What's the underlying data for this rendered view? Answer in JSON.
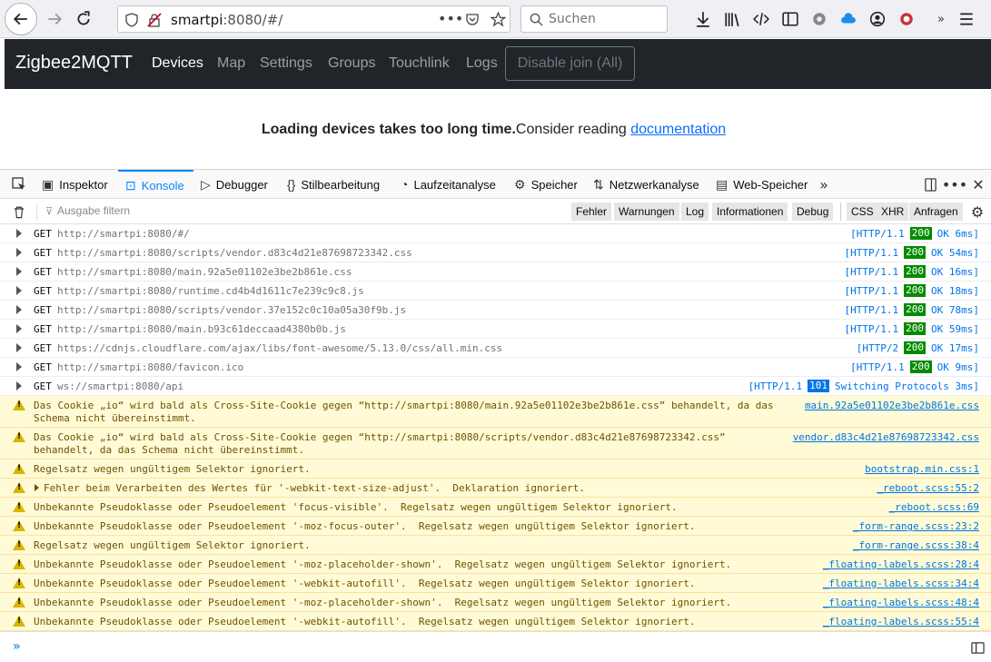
{
  "browser": {
    "url_host": "smartpi",
    "url_rest": ":8080/#/",
    "search_placeholder": "Suchen"
  },
  "page": {
    "brand": "Zigbee2MQTT",
    "nav": [
      "Devices",
      "Map",
      "Settings",
      "Groups",
      "Touchlink",
      "Logs"
    ],
    "join_button": "Disable join (All)",
    "loading_strong": "Loading devices takes too long time.",
    "loading_text": "Consider reading ",
    "loading_link": "documentation"
  },
  "devtools": {
    "tabs": [
      "Inspektor",
      "Konsole",
      "Debugger",
      "Stilbearbeitung",
      "Laufzeitanalyse",
      "Speicher",
      "Netzwerkanalyse",
      "Web-Speicher"
    ],
    "filter_placeholder": "Ausgabe filtern",
    "filter_buttons": [
      "Fehler",
      "Warnungen",
      "Log",
      "Informationen",
      "Debug"
    ],
    "type_buttons": [
      "CSS",
      "XHR",
      "Anfragen"
    ],
    "requests": [
      {
        "method": "GET",
        "url": "http://smartpi:8080/#/",
        "proto": "[HTTP/1.1",
        "code": "200",
        "rest": "OK 6ms]"
      },
      {
        "method": "GET",
        "url": "http://smartpi:8080/scripts/vendor.d83c4d21e87698723342.css",
        "proto": "[HTTP/1.1",
        "code": "200",
        "rest": "OK 54ms]"
      },
      {
        "method": "GET",
        "url": "http://smartpi:8080/main.92a5e01102e3be2b861e.css",
        "proto": "[HTTP/1.1",
        "code": "200",
        "rest": "OK 16ms]"
      },
      {
        "method": "GET",
        "url": "http://smartpi:8080/runtime.cd4b4d1611c7e239c9c8.js",
        "proto": "[HTTP/1.1",
        "code": "200",
        "rest": "OK 18ms]"
      },
      {
        "method": "GET",
        "url": "http://smartpi:8080/scripts/vendor.37e152c0c10a05a30f9b.js",
        "proto": "[HTTP/1.1",
        "code": "200",
        "rest": "OK 78ms]"
      },
      {
        "method": "GET",
        "url": "http://smartpi:8080/main.b93c61deccaad4380b0b.js",
        "proto": "[HTTP/1.1",
        "code": "200",
        "rest": "OK 59ms]"
      },
      {
        "method": "GET",
        "url": "https://cdnjs.cloudflare.com/ajax/libs/font-awesome/5.13.0/css/all.min.css",
        "proto": "[HTTP/2",
        "code": "200",
        "rest": "OK 17ms]"
      },
      {
        "method": "GET",
        "url": "http://smartpi:8080/favicon.ico",
        "proto": "[HTTP/1.1",
        "code": "200",
        "rest": "OK 9ms]"
      },
      {
        "method": "GET",
        "url": "ws://smartpi:8080/api",
        "proto": "[HTTP/1.1",
        "code": "101",
        "rest": "Switching Protocols 3ms]"
      }
    ],
    "warnings": [
      {
        "msg": "Das Cookie „io“ wird bald als Cross-Site-Cookie gegen “http://smartpi:8080/main.92a5e01102e3be2b861e.css” behandelt, da das Schema nicht übereinstimmt.",
        "src": "main.92a5e01102e3be2b861e.css"
      },
      {
        "msg": "Das Cookie „io“ wird bald als Cross-Site-Cookie gegen “http://smartpi:8080/scripts/vendor.d83c4d21e87698723342.css” behandelt, da das Schema nicht übereinstimmt.",
        "src": "vendor.d83c4d21e87698723342.css"
      },
      {
        "msg": "Regelsatz wegen ungültigem Selektor ignoriert.",
        "src": "bootstrap.min.css:1"
      },
      {
        "msg": "Fehler beim Verarbeiten des Wertes für '-webkit-text-size-adjust'.  Deklaration ignoriert.",
        "src": "_reboot.scss:55:2"
      },
      {
        "msg": "Unbekannte Pseudoklasse oder Pseudoelement 'focus-visible'.  Regelsatz wegen ungültigem Selektor ignoriert.",
        "src": "_reboot.scss:69"
      },
      {
        "msg": "Unbekannte Pseudoklasse oder Pseudoelement '-moz-focus-outer'.  Regelsatz wegen ungültigem Selektor ignoriert.",
        "src": "_form-range.scss:23:2"
      },
      {
        "msg": "Regelsatz wegen ungültigem Selektor ignoriert.",
        "src": "_form-range.scss:38:4"
      },
      {
        "msg": "Unbekannte Pseudoklasse oder Pseudoelement '-moz-placeholder-shown'.  Regelsatz wegen ungültigem Selektor ignoriert.",
        "src": "_floating-labels.scss:28:4"
      },
      {
        "msg": "Unbekannte Pseudoklasse oder Pseudoelement '-webkit-autofill'.  Regelsatz wegen ungültigem Selektor ignoriert.",
        "src": "_floating-labels.scss:34:4"
      },
      {
        "msg": "Unbekannte Pseudoklasse oder Pseudoelement '-moz-placeholder-shown'.  Regelsatz wegen ungültigem Selektor ignoriert.",
        "src": "_floating-labels.scss:48:4"
      },
      {
        "msg": "Unbekannte Pseudoklasse oder Pseudoelement '-webkit-autofill'.  Regelsatz wegen ungültigem Selektor ignoriert.",
        "src": "_floating-labels.scss:55:4"
      }
    ],
    "prompt": "»"
  }
}
